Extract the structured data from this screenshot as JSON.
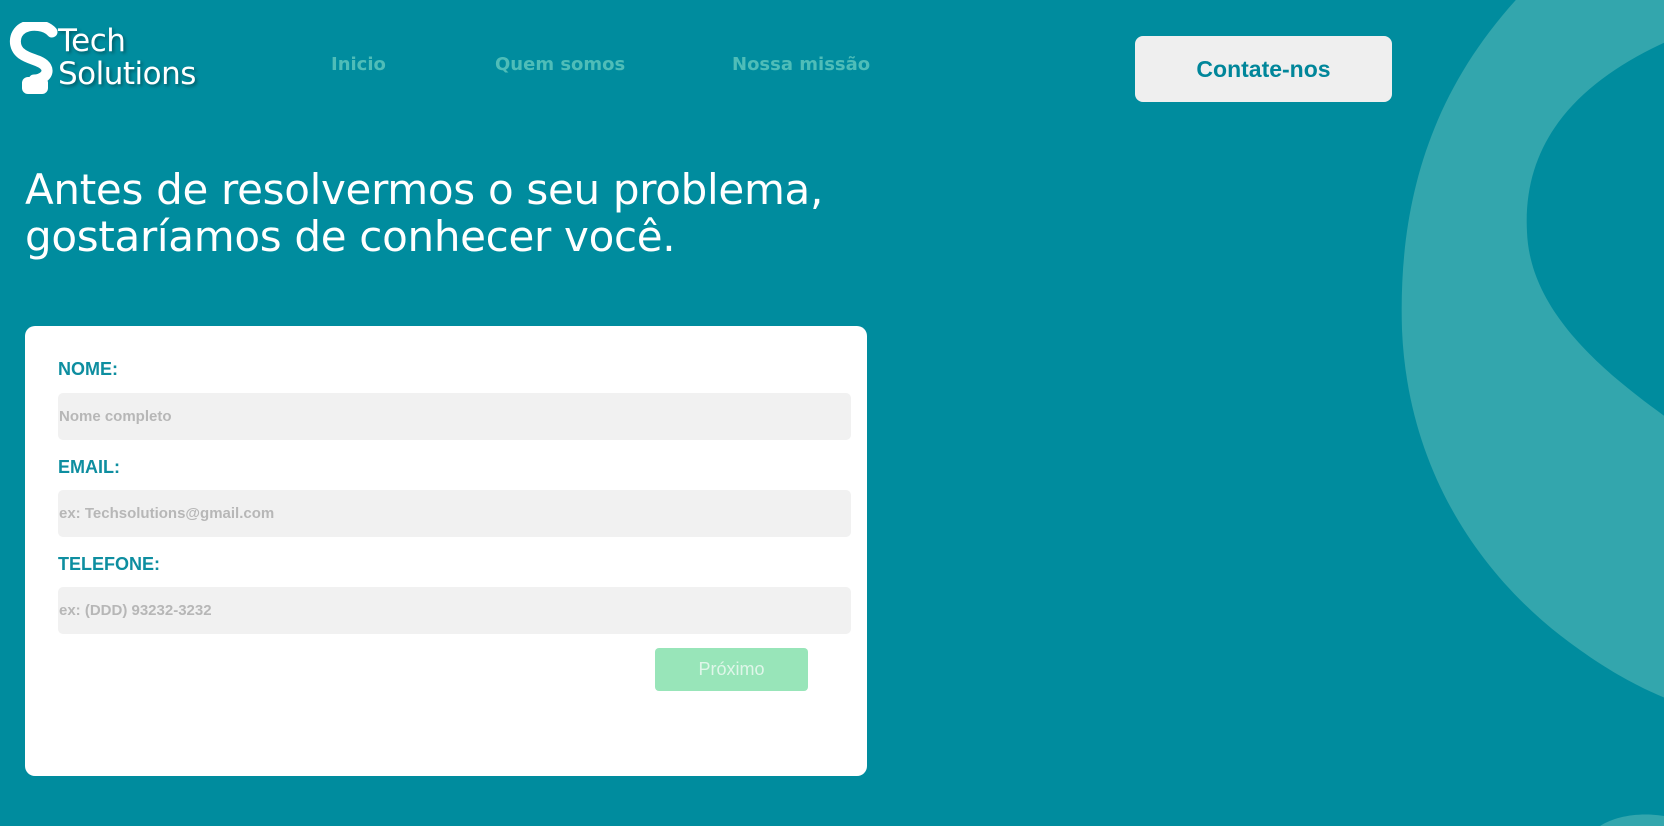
{
  "brand": {
    "name_line1": "Tech",
    "name_line2": "Solutions",
    "logo_icon": "s-letter-logo-icon"
  },
  "nav": {
    "items": [
      {
        "label": "Inicio"
      },
      {
        "label": "Quem somos"
      },
      {
        "label": "Nossa missão"
      }
    ],
    "contact_label": "Contate-nos"
  },
  "hero": {
    "line1": "Antes de resolvermos o seu problema,",
    "line2": "gostaríamos de conhecer você."
  },
  "form": {
    "name_label": "NOME:",
    "name_placeholder": "Nome completo",
    "name_value": "",
    "email_label": "EMAIL:",
    "email_placeholder": "ex: Techsolutions@gmail.com",
    "email_value": "",
    "phone_label": "TELEFONE:",
    "phone_placeholder": "ex: (DDD) 93232-3232",
    "phone_value": "",
    "next_label": "Próximo"
  },
  "colors": {
    "background": "#008c9e",
    "nav_text": "#4fbdb8",
    "label_text": "#0e8ea0",
    "next_button": "#98e5b9",
    "decoration": "#33a6ad"
  }
}
